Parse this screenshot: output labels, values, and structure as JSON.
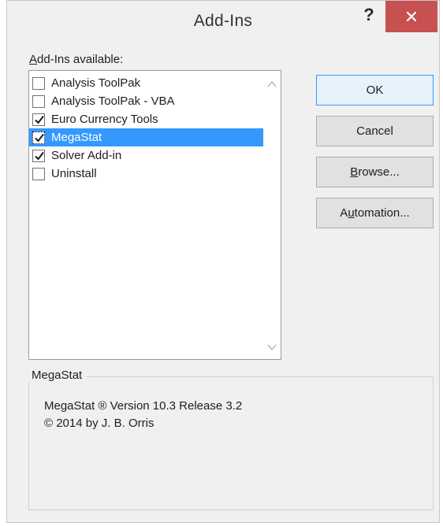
{
  "window": {
    "title": "Add-Ins",
    "help_glyph": "?",
    "close_color": "#c75050"
  },
  "list": {
    "label_underlined": "A",
    "label_rest": "dd-Ins available:",
    "items": [
      {
        "label": "Analysis ToolPak",
        "checked": false,
        "selected": false
      },
      {
        "label": "Analysis ToolPak - VBA",
        "checked": false,
        "selected": false
      },
      {
        "label": "Euro Currency Tools",
        "checked": true,
        "selected": false
      },
      {
        "label": "MegaStat",
        "checked": true,
        "selected": true
      },
      {
        "label": "Solver Add-in",
        "checked": true,
        "selected": false
      },
      {
        "label": "Uninstall",
        "checked": false,
        "selected": false
      }
    ],
    "selection_color": "#3399ff"
  },
  "buttons": {
    "ok": "OK",
    "cancel": "Cancel",
    "browse_underlined": "B",
    "browse_rest": "rowse...",
    "automation_pre": "A",
    "automation_underlined": "u",
    "automation_rest": "tomation..."
  },
  "details": {
    "group_title": "MegaStat",
    "line1": "MegaStat ® Version 10.3 Release 3.2",
    "line2": "© 2014 by J. B. Orris"
  }
}
